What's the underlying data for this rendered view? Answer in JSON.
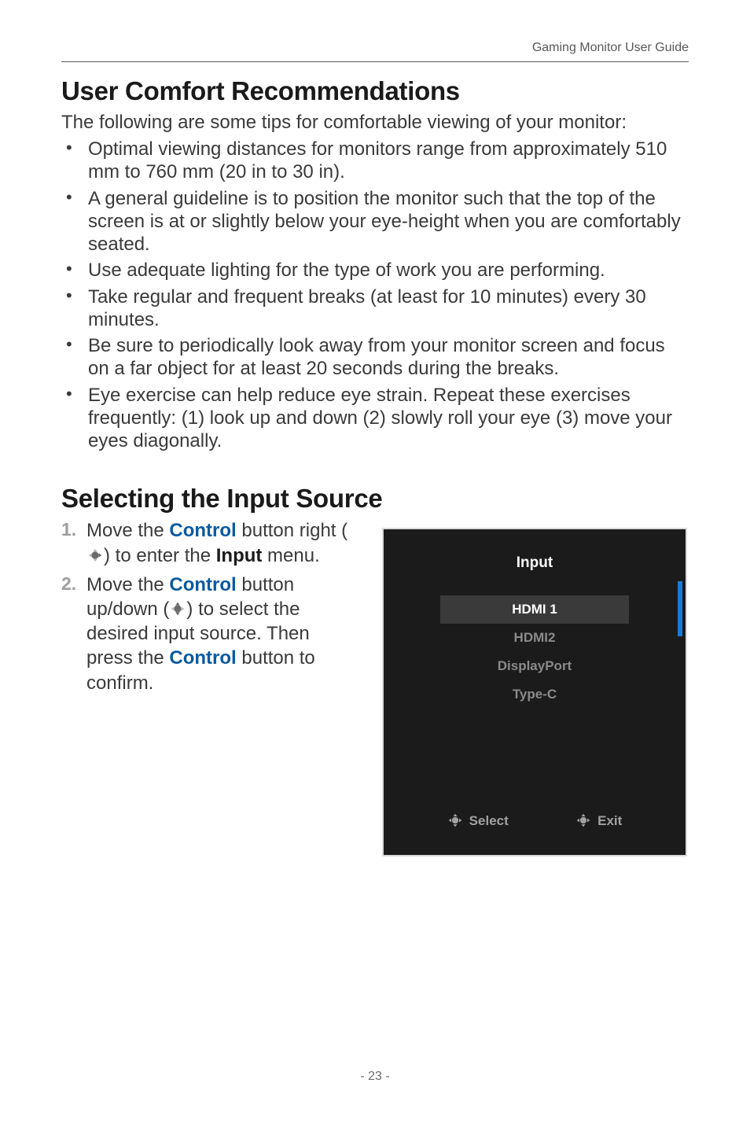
{
  "header": {
    "running_head": "Gaming Monitor User Guide"
  },
  "section1": {
    "heading": "User Comfort Recommendations",
    "intro": "The following are some tips for comfortable viewing of your monitor:",
    "bullets": [
      "Optimal viewing distances for monitors range from approximately 510 mm to 760 mm (20 in to 30 in).",
      "A general guideline is to position the monitor such that the top of the screen is at or slightly below your eye-height when you are comfortably seated.",
      "Use adequate lighting for the type of work you are performing.",
      "Take regular and frequent breaks (at least for 10 minutes) every 30 minutes.",
      "Be sure to periodically look away from your monitor screen and focus on a far object for at least 20 seconds during the breaks.",
      "Eye exercise can help reduce eye strain. Repeat these exercises frequently: (1) look up and down (2) slowly roll your eye (3) move your eyes diagonally."
    ]
  },
  "section2": {
    "heading": "Selecting the Input Source",
    "steps": {
      "s1": {
        "pre": "Move the ",
        "kw1": "Control",
        "mid1": " button right (",
        "mid2": ") to enter the ",
        "kw2": "Input",
        "post": " menu."
      },
      "s2": {
        "pre": "Move the ",
        "kw1": "Control",
        "mid1": " button up/down (",
        "mid2": ") to select the desired input source. Then press the ",
        "kw2": "Control",
        "post": " button to confirm."
      }
    }
  },
  "osd": {
    "title": "Input",
    "items": [
      "HDMI 1",
      "HDMI2",
      "DisplayPort",
      "Type-C"
    ],
    "selected_index": 0,
    "footer": {
      "select": "Select",
      "exit": "Exit"
    }
  },
  "footer": {
    "page_number": "- 23 -"
  },
  "icons": {
    "joystick_right": "joystick-right-icon",
    "joystick_updown": "joystick-updown-icon",
    "joystick_select": "joystick-select-icon",
    "joystick_exit": "joystick-exit-icon"
  }
}
